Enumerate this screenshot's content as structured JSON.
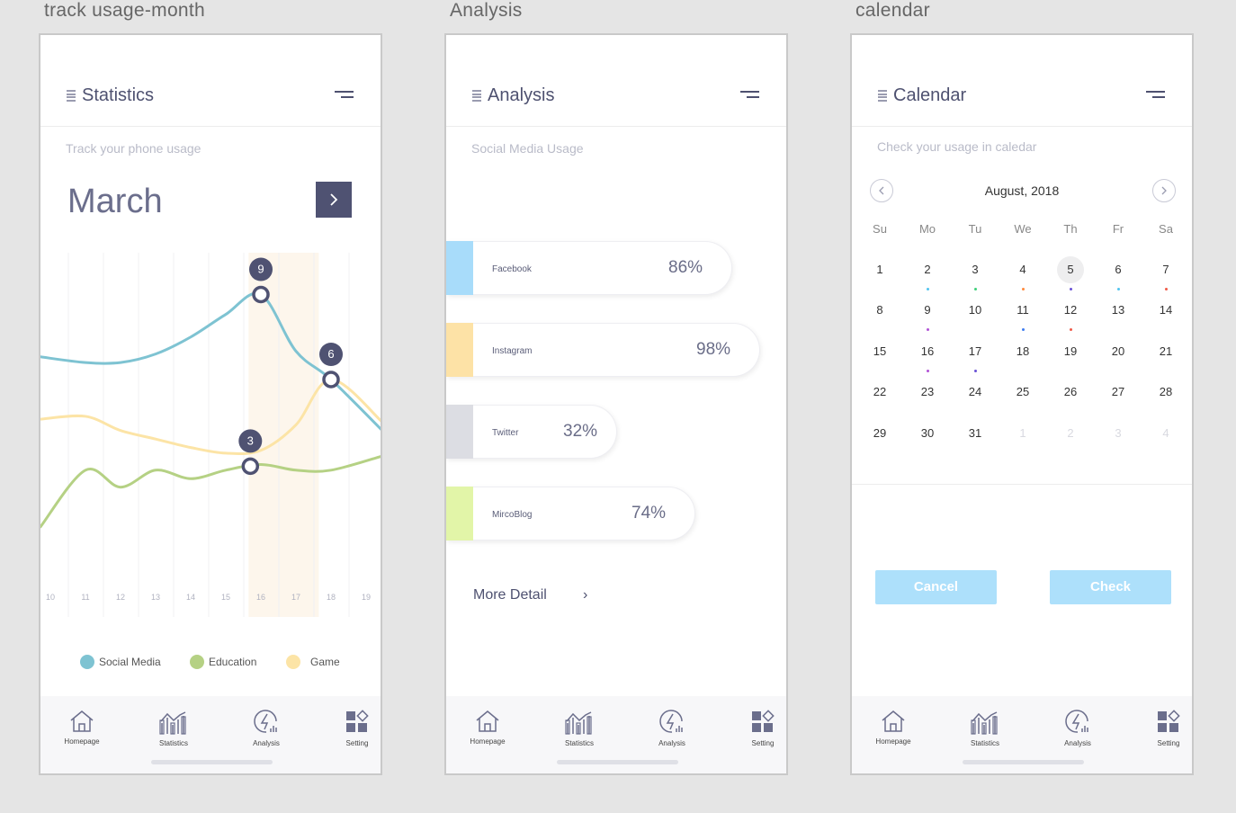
{
  "artboards": [
    "track usage-month",
    "Analysis",
    "calendar"
  ],
  "tabs": [
    "Homepage",
    "Statistics",
    "Analysis",
    "Setting"
  ],
  "statistics": {
    "title": "Statistics",
    "subtitle": "Track your phone usage",
    "month": "March",
    "chart_data": {
      "type": "line",
      "x": [
        10,
        11,
        12,
        13,
        14,
        15,
        16,
        17,
        18,
        19
      ],
      "categories": [
        "10",
        "11",
        "12",
        "13",
        "14",
        "15",
        "16",
        "17",
        "18",
        "19"
      ],
      "series": [
        {
          "name": "Social Media",
          "color": "#7ec3d2",
          "values": [
            6.8,
            6.6,
            6.6,
            6.9,
            7.5,
            8.3,
            9.0,
            7.0,
            6.0,
            4.2
          ]
        },
        {
          "name": "Game",
          "color": "#fce4a6",
          "values": [
            4.6,
            4.7,
            4.2,
            3.9,
            3.6,
            3.4,
            3.5,
            4.4,
            6.0,
            4.5
          ]
        },
        {
          "name": "Education",
          "color": "#b5d184",
          "values": [
            0.8,
            2.8,
            2.2,
            2.8,
            2.5,
            2.8,
            3.0,
            2.8,
            2.8,
            3.3
          ]
        }
      ],
      "markers": [
        {
          "series": "Social Media",
          "x": 16,
          "label": "9"
        },
        {
          "series": "Game",
          "x": 18,
          "label": "6"
        },
        {
          "series": "Education",
          "x": 15.7,
          "label": "3"
        }
      ],
      "highlight_x": [
        16,
        17
      ],
      "grid": true,
      "legend": "bottom"
    }
  },
  "analysis": {
    "title": "Analysis",
    "subtitle": "Social Media Usage",
    "items": [
      {
        "name": "Facebook",
        "percent": "86%",
        "value": 86,
        "color": "#a8dcfa"
      },
      {
        "name": "Instagram",
        "percent": "98%",
        "value": 98,
        "color": "#fde2a6"
      },
      {
        "name": "Twitter",
        "percent": "32%",
        "value": 32,
        "color": "#dcdde3"
      },
      {
        "name": "MircoBlog",
        "percent": "74%",
        "value": 74,
        "color": "#e2f5a8"
      }
    ],
    "more": "More Detail",
    "more_chevron": "›"
  },
  "calendar": {
    "title": "Calendar",
    "subtitle": "Check your usage in caledar",
    "month": "August, 2018",
    "weekdays": [
      "Su",
      "Mo",
      "Tu",
      "We",
      "Th",
      "Fr",
      "Sa"
    ],
    "weeks": [
      [
        "1",
        "2",
        "3",
        "4",
        "5",
        "6",
        "7"
      ],
      [
        "8",
        "9",
        "10",
        "11",
        "12",
        "13",
        "14"
      ],
      [
        "15",
        "16",
        "17",
        "18",
        "19",
        "20",
        "21"
      ],
      [
        "22",
        "23",
        "24",
        "25",
        "26",
        "27",
        "28"
      ],
      [
        "29",
        "30",
        "31",
        "1",
        "2",
        "3",
        "4"
      ]
    ],
    "selected": "5",
    "cancel": "Cancel",
    "check": "Check"
  },
  "colors": {
    "dark": "#4e5170",
    "accent_button": "#ade0fb",
    "dot_cyan": "#52c4f0",
    "dot_green": "#3fd07a",
    "dot_orange": "#ff8a3d",
    "dot_purple": "#6a52d6",
    "dot_red": "#f05a48",
    "dot_blue": "#3f7df0",
    "dot_magenta": "#b152d6"
  }
}
